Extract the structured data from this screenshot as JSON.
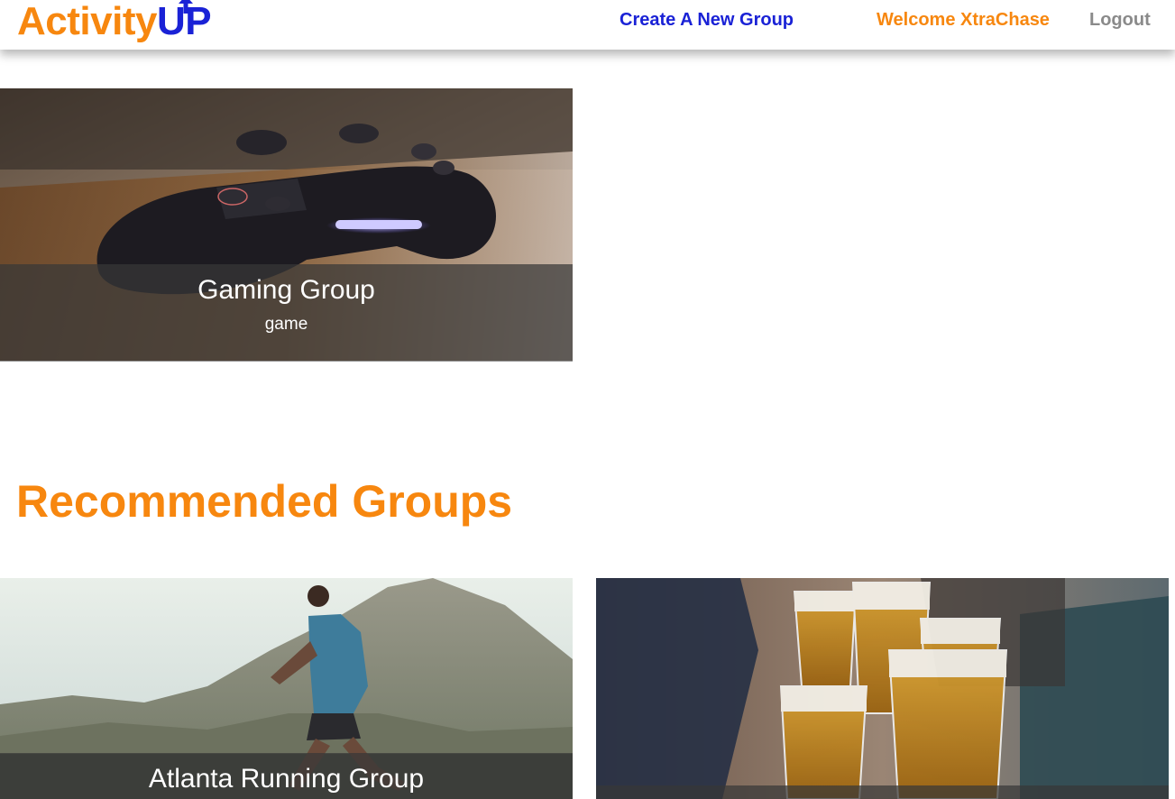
{
  "header": {
    "logo_part1": "Activity",
    "logo_part2": "UP",
    "nav": {
      "create": "Create A New Group",
      "welcome": "Welcome XtraChase",
      "logout": "Logout"
    }
  },
  "my_groups": [
    {
      "title": "Gaming Group",
      "tag": "game",
      "image": "game-controller-photo"
    }
  ],
  "recommended": {
    "heading": "Recommended Groups",
    "groups": [
      {
        "title": "Atlanta Running Group",
        "image": "runner-photo"
      },
      {
        "title": "",
        "image": "beer-toast-photo"
      }
    ]
  },
  "colors": {
    "brand_orange": "#f7870f",
    "brand_blue": "#1a22d6",
    "logout_gray": "#8a8a8a"
  }
}
